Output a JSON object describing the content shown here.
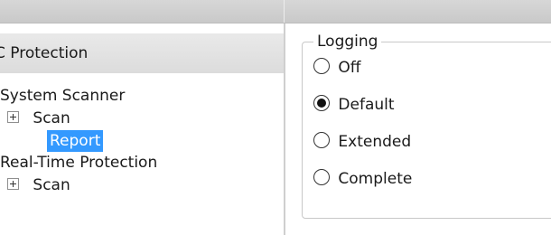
{
  "left_panel": {
    "header": "C Protection",
    "tree": [
      {
        "label": "System Scanner",
        "expandable": false
      },
      {
        "label": "Scan",
        "expandable": true
      },
      {
        "label": "Report",
        "expandable": false,
        "selected": true
      },
      {
        "label": "Real-Time Protection",
        "expandable": false
      },
      {
        "label": "Scan",
        "expandable": true
      }
    ]
  },
  "logging": {
    "legend": "Logging",
    "options": [
      {
        "label": "Off",
        "checked": false
      },
      {
        "label": "Default",
        "checked": true
      },
      {
        "label": "Extended",
        "checked": false
      },
      {
        "label": "Complete",
        "checked": false
      }
    ]
  },
  "colors": {
    "selection": "#3399ff",
    "header_bg": "#dcdcdc"
  }
}
